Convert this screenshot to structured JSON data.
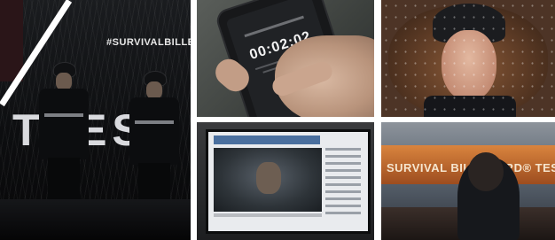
{
  "panels": {
    "main": {
      "hashtag": "#SURVIVALBILLBO",
      "big_word": "TTEST"
    },
    "phone": {
      "timer": "00:02:02"
    },
    "night_billboard": {
      "sign_text": "SURVIVAL BILLBOARD® TEST"
    }
  }
}
